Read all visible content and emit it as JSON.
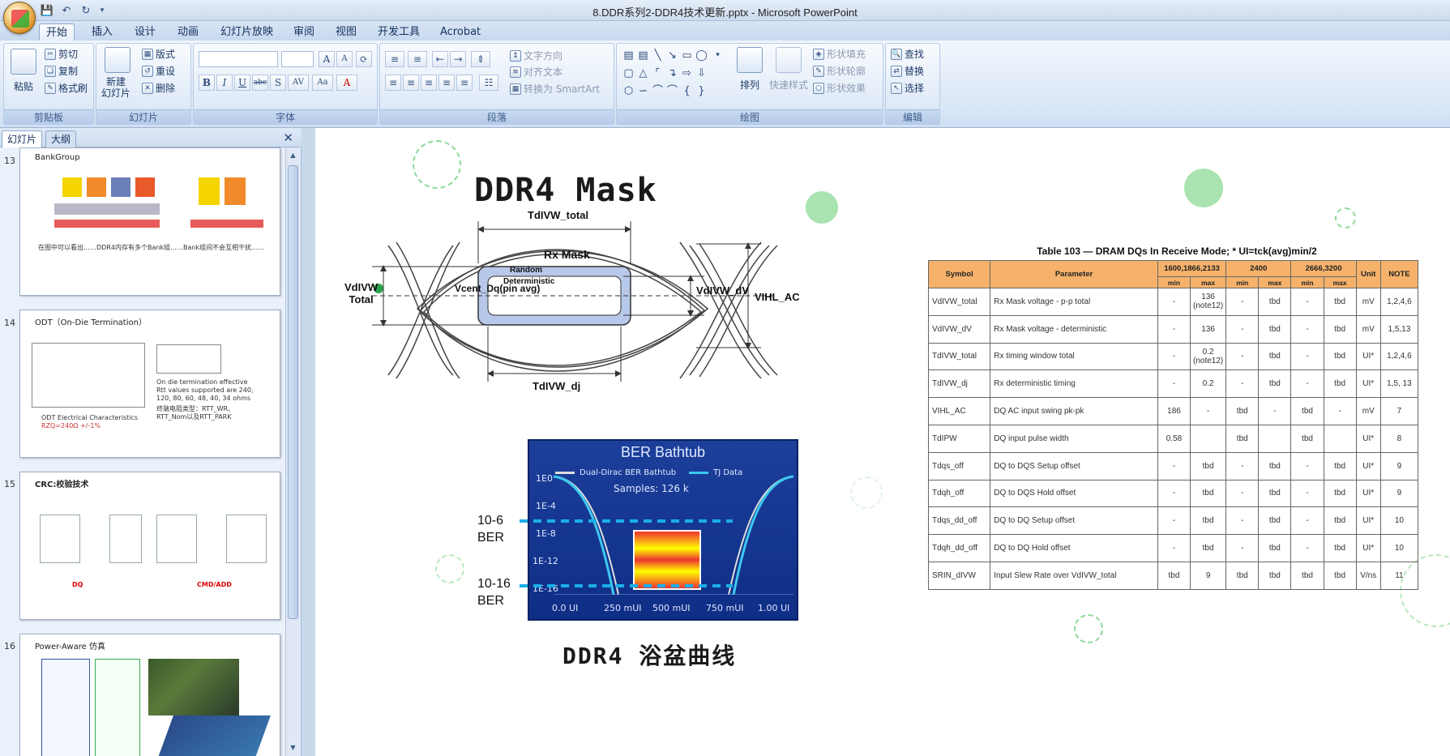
{
  "window": {
    "title": "8.DDR系列2-DDR4技术更新.pptx - Microsoft PowerPoint"
  },
  "tabs": [
    "开始",
    "插入",
    "设计",
    "动画",
    "幻灯片放映",
    "审阅",
    "视图",
    "开发工具",
    "Acrobat"
  ],
  "ribbon": {
    "clipboard": {
      "paste": "粘贴",
      "cut": "剪切",
      "copy": "复制",
      "format_painter": "格式刷",
      "label": "剪贴板"
    },
    "slides": {
      "new_slide": "新建\n幻灯片",
      "layout": "版式",
      "reset": "重设",
      "delete": "删除",
      "label": "幻灯片"
    },
    "font": {
      "label": "字体"
    },
    "paragraph": {
      "text_direction": "文字方向",
      "align_text": "对齐文本",
      "smartart": "转换为 SmartArt",
      "label": "段落"
    },
    "drawing": {
      "arrange": "排列",
      "quick_styles": "快速样式",
      "fill": "形状填充",
      "outline": "形状轮廓",
      "effects": "形状效果",
      "label": "绘图"
    },
    "editing": {
      "find": "查找",
      "replace": "替换",
      "select": "选择",
      "label": "编辑"
    }
  },
  "left_pane": {
    "tabs": [
      "幻灯片",
      "大纲"
    ],
    "slides": [
      {
        "number": "13",
        "title": "BankGroup",
        "body": "在图中可以看出……DDR4内存有多个Bank组……Bank组间不会互相干扰……"
      },
      {
        "number": "14",
        "title": "ODT（On-Die Termination）",
        "body_lines": [
          "On die termination effective",
          "Rtt values supported are 240,",
          "120, 80, 60, 48, 40, 34 ohms",
          "终端电阻类型：RTT_WR、",
          "RTT_Nom以及RTT_PARK"
        ],
        "caption": "ODT Electrical Characteristics",
        "caption2": "RZQ=240Ω +/-1%"
      },
      {
        "number": "15",
        "title": "CRC:校验技术",
        "label_dq": "DQ",
        "label_cmd": "CMD/ADD"
      },
      {
        "number": "16",
        "title": "Power-Aware 仿真"
      }
    ]
  },
  "slide": {
    "title": "DDR4 Mask",
    "mask_diagram": {
      "tdivw_total": "TdIVW_total",
      "rx_mask": "Rx Mask",
      "random": "Random",
      "deterministic": "Deterministic",
      "vcent": "Vcent_Dq(pin avg)",
      "vdivw_total": "VdIVW\nTotal",
      "vdivw_dv": "VdIVW_dV",
      "vihl_ac": "VIHL_AC",
      "tdivw_dj": "TdIVW_dj"
    },
    "bathtub": {
      "title": "BER Bathtub",
      "legend": [
        "Dual-Dirac BER Bathtub",
        "TJ Data"
      ],
      "samples": "Samples: 126 k",
      "y_ticks": [
        "1E0",
        "1E-4",
        "1E-8",
        "1E-12",
        "1E-16"
      ],
      "x_ticks": [
        "0.0 UI",
        "250 mUI",
        "500 mUI",
        "750 mUI",
        "1.00 UI"
      ],
      "ber_label_1": "10-6\nBER",
      "ber_label_2": "10-16\nBER",
      "caption": "DDR4 浴盆曲线"
    },
    "table": {
      "caption": "Table 103 — DRAM DQs In Receive Mode; * UI=tck(avg)min/2",
      "header": {
        "symbol": "Symbol",
        "parameter": "Parameter",
        "groups": [
          "1600,1866,2133",
          "2400",
          "2666,3200"
        ],
        "unit": "Unit",
        "note": "NOTE",
        "min": "min",
        "max": "max"
      },
      "rows": [
        [
          "VdIVW_total",
          "Rx Mask voltage - p-p total",
          "-",
          "136\n(note12)",
          "-",
          "tbd",
          "-",
          "tbd",
          "mV",
          "1,2,4,6"
        ],
        [
          "VdIVW_dV",
          "Rx Mask voltage - deterministic",
          "-",
          "136",
          "-",
          "tbd",
          "-",
          "tbd",
          "mV",
          "1,5,13"
        ],
        [
          "TdIVW_total",
          "Rx  timing window total",
          "-",
          "0.2\n(note12)",
          "-",
          "tbd",
          "-",
          "tbd",
          "UI*",
          "1,2,4,6"
        ],
        [
          "TdIVW_dj",
          "Rx deterministic timing",
          "-",
          "0.2",
          "-",
          "tbd",
          "-",
          "tbd",
          "UI*",
          "1,5, 13"
        ],
        [
          "VIHL_AC",
          "DQ AC input swing pk-pk",
          "186",
          "-",
          "tbd",
          "-",
          "tbd",
          "-",
          "mV",
          "7"
        ],
        [
          "TdIPW",
          "DQ input pulse width",
          "0.58",
          "",
          "tbd",
          "",
          "tbd",
          "",
          "UI*",
          "8"
        ],
        [
          "Tdqs_off",
          "DQ to DQS Setup offset",
          "-",
          "tbd",
          "-",
          "tbd",
          "-",
          "tbd",
          "UI*",
          "9"
        ],
        [
          "Tdqh_off",
          "DQ to DQS Hold offset",
          "-",
          "tbd",
          "-",
          "tbd",
          "-",
          "tbd",
          "UI*",
          "9"
        ],
        [
          "Tdqs_dd_off",
          "DQ to DQ Setup offset",
          "-",
          "tbd",
          "-",
          "tbd",
          "-",
          "tbd",
          "UI*",
          "10"
        ],
        [
          "Tdqh_dd_off",
          "DQ to DQ Hold offset",
          "-",
          "tbd",
          "-",
          "tbd",
          "-",
          "tbd",
          "UI*",
          "10"
        ],
        [
          "SRIN_dIVW",
          "Input Slew Rate over VdIVW_total",
          "tbd",
          "9",
          "tbd",
          "tbd",
          "tbd",
          "tbd",
          "V/ns",
          "11"
        ]
      ]
    }
  },
  "colors": {
    "ribbon_bg": "#dce8f7",
    "table_header": "#f6b26b",
    "ber_bg": "#1c3f9a",
    "bubble_green": "#8fd99a"
  }
}
